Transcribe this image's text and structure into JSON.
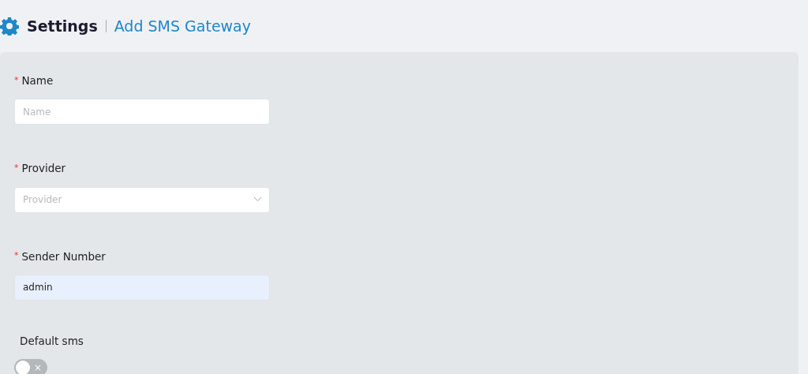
{
  "header": {
    "title": "Settings",
    "subtitle": "Add SMS Gateway"
  },
  "fields": [
    {
      "kind": "text",
      "label": "Name",
      "required_mark": "*",
      "placeholder": "Name"
    },
    {
      "kind": "select",
      "label": "Provider",
      "required_mark": "*",
      "placeholder": "Provider"
    },
    {
      "kind": "text",
      "label": "Sender Number",
      "required_mark": "*",
      "value": "admin",
      "autofilled": true
    },
    {
      "kind": "switch",
      "label": "Default sms",
      "on": false,
      "off_symbol": "×"
    }
  ]
}
